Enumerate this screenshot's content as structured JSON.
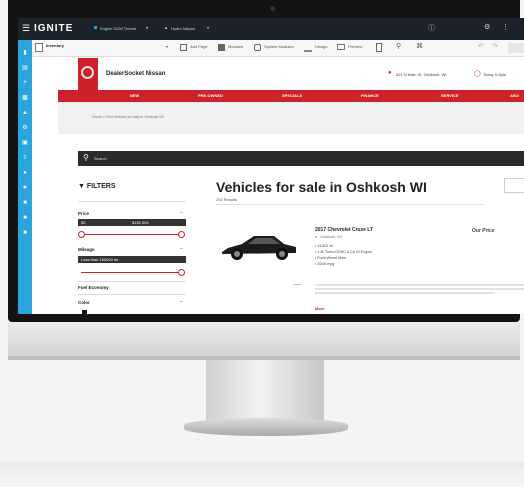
{
  "ignite": {
    "brand": "IGNITE",
    "theme_selector": "Engine DCM Theme",
    "account_selector": "Hydro Nissan",
    "toolbar": {
      "page_selector": "Inventory",
      "tools": [
        "Add Page",
        "Modules",
        "System Modules",
        "Design",
        "Preview"
      ]
    }
  },
  "site": {
    "dealer_name": "DealerSocket Nissan",
    "address": "321 N Main St, Oshkosh, WI",
    "hours": "Today 9-6pm",
    "nav": [
      "NEW",
      "PRE-OWNED",
      "SPECIALS",
      "FINANCE",
      "SERVICE",
      "ABO"
    ],
    "breadcrumb": "Home  >  Find vehicles for sale in Oshkosh WI",
    "search_placeholder": "Search",
    "filters": {
      "heading": "FILTERS",
      "price_label": "Price",
      "price_min": "$0",
      "price_max": "$152,000",
      "mileage_label": "Mileage",
      "mileage_value": "Less than 150000 mi.",
      "fuel_label": "Fuel Economy",
      "color_label": "Color"
    },
    "page_title": "Vehicles for sale in Oshkosh WI",
    "results_count": "292 Results",
    "vehicle": {
      "title": "2017 Chevrolet Cruze LT",
      "location": "Oshkosh, WI",
      "specs": [
        "13,502 mi",
        "1.4L Turbo DOHC 4 Cyl DI Engine",
        "Front Wheel Drive",
        "30/40 mpg"
      ],
      "price_label": "Our Price",
      "more_link": "More"
    }
  },
  "colors": {
    "brand_red": "#cd2229",
    "ignite_dark": "#1d232a",
    "strip_blue": "#2aa4dc"
  }
}
